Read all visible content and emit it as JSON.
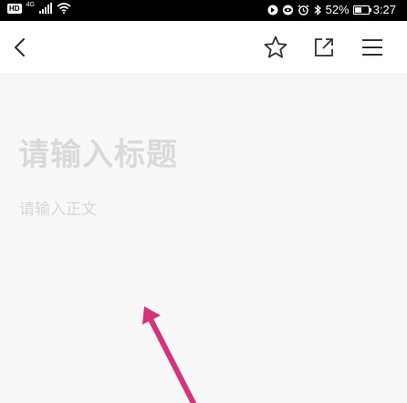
{
  "status_bar": {
    "hd_label": "HD",
    "network_label": "4G",
    "battery_text": "52%",
    "battery_level": 0.52,
    "time": "3:27",
    "icons": [
      "hd-icon",
      "signal-icon",
      "wifi-icon",
      "data-saver-icon",
      "eye-icon",
      "alarm-icon",
      "bluetooth-icon",
      "battery-icon"
    ]
  },
  "nav": {
    "icons": [
      "back-arrow-icon",
      "star-icon",
      "share-icon",
      "menu-icon"
    ]
  },
  "editor": {
    "title_placeholder": "请输入标题",
    "body_placeholder": "请输入正文"
  },
  "annotation": {
    "arrow_color": "#d6327a"
  }
}
